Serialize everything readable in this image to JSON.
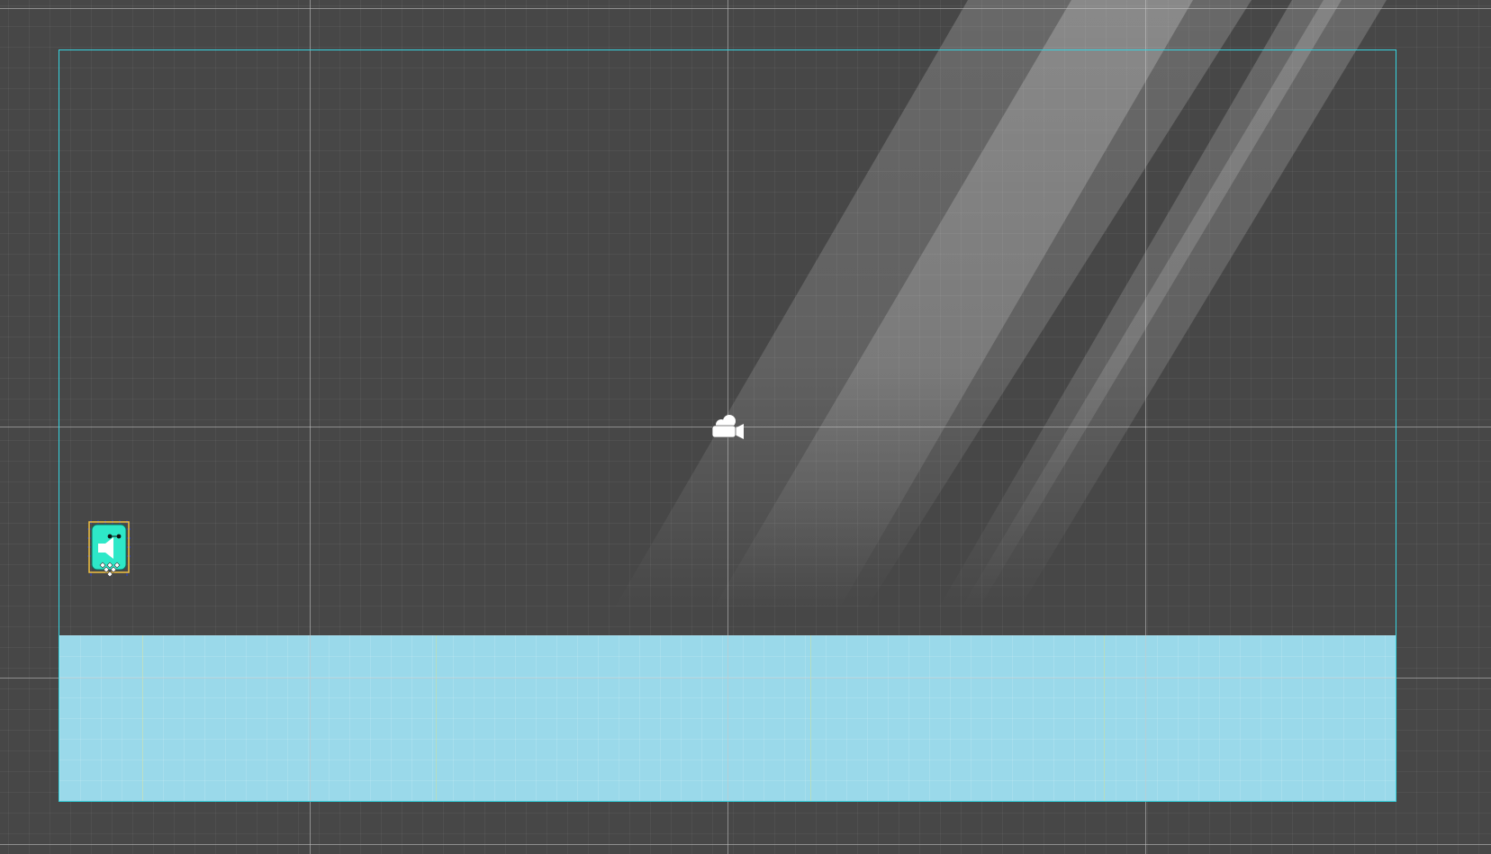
{
  "scene": {
    "background_color": "#474747",
    "camera_frame_color": "#35d4e0",
    "ground_color": "#9ad9ea",
    "sprite_color": "#2ee8c8",
    "selection_color": "#f0c040"
  },
  "icons": {
    "camera": "camera-icon",
    "sprite": "speaker-icon",
    "pivot": "move-pivot-icon"
  }
}
